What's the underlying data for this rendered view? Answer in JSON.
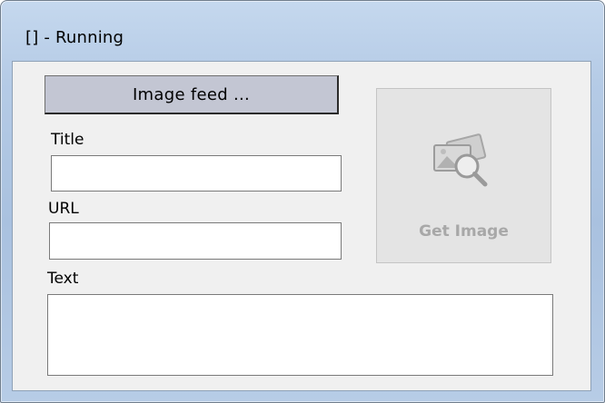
{
  "window": {
    "title": "[] - Running"
  },
  "main": {
    "feed_button_label": "Image feed ...",
    "title_label": "Title",
    "title_value": "",
    "url_label": "URL",
    "url_value": "",
    "text_label": "Text",
    "text_value": "",
    "get_image_label": "Get Image",
    "get_image_icon": "image-search-icon",
    "get_image_enabled": false
  }
}
